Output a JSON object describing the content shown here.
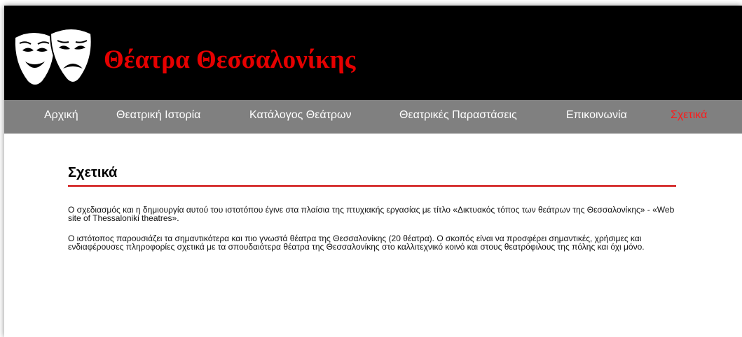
{
  "header": {
    "title": "Θέατρα Θεσσαλονίκης",
    "logo_icon": "theater-masks-icon"
  },
  "nav": {
    "items": [
      {
        "label": "Αρχική",
        "active": false
      },
      {
        "label": "Θεατρική Ιστορία",
        "active": false
      },
      {
        "label": "Κατάλογος Θεάτρων",
        "active": false
      },
      {
        "label": "Θεατρικές Παραστάσεις",
        "active": false
      },
      {
        "label": "Επικοινωνία",
        "active": false
      },
      {
        "label": "Σχετικά",
        "active": true
      }
    ]
  },
  "main": {
    "heading": "Σχετικά",
    "paragraphs": [
      "Ο σχεδιασμός και η δημιουργία αυτού του ιστοτόπου έγινε στα πλαίσια της πτυχιακής εργασίας με τίτλο «Δικτυακός τόπος των θεάτρων της Θεσσαλονίκης» - «Web site of Thessaloniki theatres».",
      "Ο ιστότοπος παρουσιάζει τα σημαντικότερα και πιο γνωστά θέατρα της Θεσσαλονίκης (20 θέατρα). Ο σκοπός είναι να προσφέρει σημαντικές, χρήσιμες και ενδιαφέρουσες πληροφορίες σχετικά με τα σπουδαιότερα θέατρα της Θεσσαλονίκης στο καλλιτεχνικό κοινό και στους θεατρόφιλους της πόλης και όχι μόνο."
    ]
  },
  "colors": {
    "header_bg": "#000000",
    "title": "#e60000",
    "nav_bg": "#808080",
    "nav_text": "#ffffff",
    "nav_active": "#ff1a1a",
    "heading_rule": "#cc0000"
  }
}
